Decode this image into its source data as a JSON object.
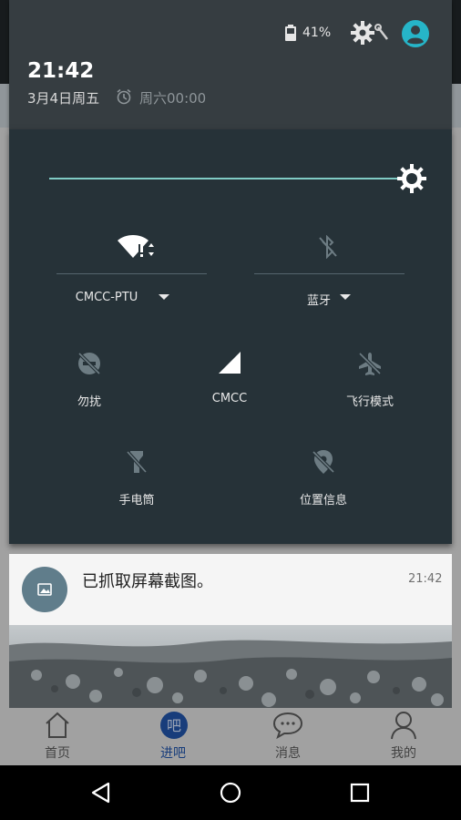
{
  "status": {
    "battery_pct": "41%",
    "icons": [
      "battery-icon",
      "gear-icon",
      "wrench-icon",
      "account-icon"
    ]
  },
  "header": {
    "time": "21:42",
    "date": "3月4日周五",
    "alarm": "周六00:00"
  },
  "quick_settings": {
    "brightness_level": 1.0,
    "wifi": {
      "label": "CMCC-PTU",
      "icon": "wifi-icon"
    },
    "bluetooth": {
      "label": "蓝牙",
      "icon": "bluetooth-off-icon"
    },
    "dnd": {
      "label": "勿扰",
      "icon": "dnd-off-icon"
    },
    "cellular": {
      "label": "CMCC",
      "icon": "cellular-signal-icon"
    },
    "airplane": {
      "label": "飞行模式",
      "icon": "airplane-off-icon"
    },
    "flashlight": {
      "label": "手电筒",
      "icon": "flashlight-off-icon"
    },
    "location": {
      "label": "位置信息",
      "icon": "location-off-icon"
    }
  },
  "notification": {
    "title": "已抓取屏幕截图。",
    "time": "21:42",
    "icon": "image-icon"
  },
  "app_nav": {
    "items": [
      {
        "label": "首页",
        "icon": "home-icon"
      },
      {
        "label": "进吧",
        "icon": "ba-icon",
        "badge": "吧"
      },
      {
        "label": "消息",
        "icon": "message-icon"
      },
      {
        "label": "我的",
        "icon": "profile-icon"
      }
    ]
  },
  "system_nav": {
    "icons": [
      "back-icon",
      "home-circle-icon",
      "recents-icon"
    ]
  },
  "colors": {
    "accent": "#80cbc4",
    "qs_background": "#263238",
    "avatar": "#26b5c8",
    "app_active": "#1f4f9e"
  }
}
